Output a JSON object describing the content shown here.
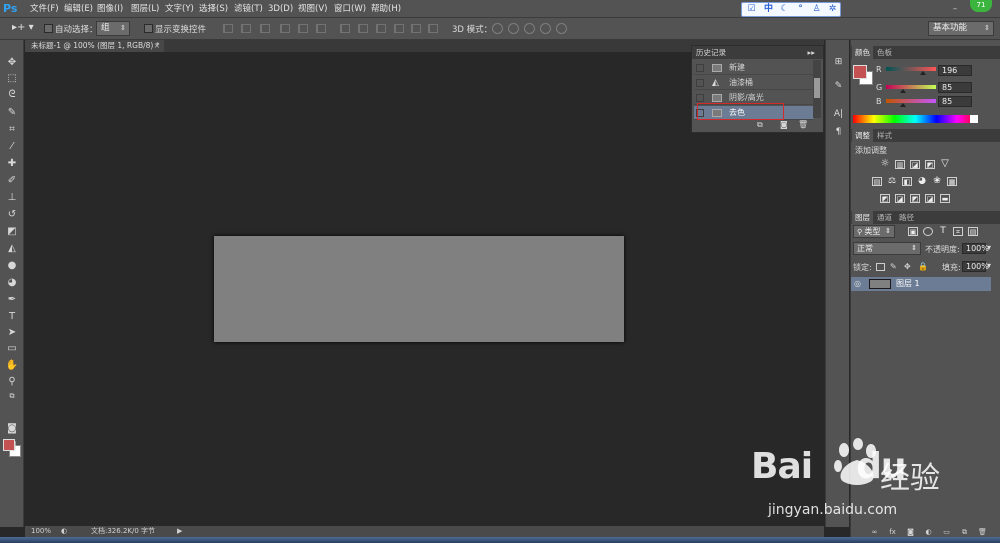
{
  "app": {
    "logo": "Ps"
  },
  "menubar": {
    "items": [
      "文件(F)",
      "编辑(E)",
      "图像(I)",
      "图层(L)",
      "文字(Y)",
      "选择(S)",
      "滤镜(T)",
      "3D(D)",
      "视图(V)",
      "窗口(W)",
      "帮助(H)"
    ],
    "ime": [
      "中"
    ],
    "badge": "71"
  },
  "options": {
    "auto_select_label": "自动选择：",
    "auto_select_value": "组",
    "show_transform_label": "显示变换控件",
    "mode3d_label": "3D 模式：",
    "workspace": "基本功能"
  },
  "document": {
    "tab_title": "未标题-1 @ 100% (图层 1, RGB/8) *",
    "zoom": "100%",
    "doc_info": "文档:326.2K/0 字节"
  },
  "history": {
    "title": "历史记录",
    "steps": [
      "新建",
      "油漆桶",
      "阴影/高光",
      "去色"
    ]
  },
  "color_panel": {
    "tabs": [
      "颜色",
      "色板"
    ],
    "sliders": [
      {
        "label": "R",
        "value": "196"
      },
      {
        "label": "G",
        "value": "85"
      },
      {
        "label": "B",
        "value": "85"
      }
    ],
    "foreground": "#c45252",
    "background": "#ffffff"
  },
  "adjustments": {
    "tabs": [
      "调整",
      "样式"
    ],
    "title": "添加调整"
  },
  "layers": {
    "tabs": [
      "图层",
      "通道",
      "路径"
    ],
    "filter_kind": "类型",
    "blend_mode": "正常",
    "opacity_label": "不透明度:",
    "opacity_value": "100%",
    "lock_label": "锁定:",
    "fill_label": "填充:",
    "fill_value": "100%",
    "layer_name": "图层 1"
  },
  "watermark": {
    "brand": "Bai",
    "brand_tail": "du",
    "cn": "经验",
    "url": "jingyan.baidu.com"
  }
}
